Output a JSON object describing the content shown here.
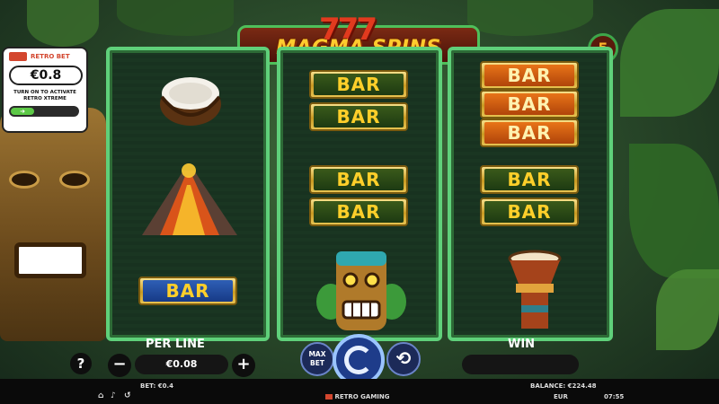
{
  "game": {
    "logo_number": "777",
    "logo_title": "MAGMA SPINS",
    "paylines": "5"
  },
  "retro_bet": {
    "brand": "RETRO BET",
    "amount": "€0.8",
    "note": "TURN ON TO ACTIVATE RETRO XTREME",
    "toggle_icon": "arrow-right-icon"
  },
  "reels": [
    {
      "symbols": [
        "coconut",
        "volcano",
        "BAR"
      ]
    },
    {
      "symbols": [
        "BAR",
        "BAR",
        "BAR",
        "BAR",
        "tiki-mask"
      ]
    },
    {
      "symbols": [
        "BAR",
        "BAR",
        "BAR",
        "BAR",
        "BAR",
        "drum"
      ]
    }
  ],
  "bar_label": "BAR",
  "controls": {
    "help_label": "?",
    "per_line_label": "PER LINE",
    "per_line_value": "€0.08",
    "minus_label": "−",
    "plus_label": "+",
    "max_bet_label": "MAX BET",
    "win_label": "WIN",
    "win_value": ""
  },
  "footer": {
    "bet": "BET: €0.4",
    "balance": "BALANCE: €224.48",
    "brand": "RETRO GAMING",
    "currency": "EUR",
    "time": "07:55"
  },
  "colors": {
    "reel_border": "#5fd07a",
    "bar_gold": "#c99a22",
    "logo_yellow": "#ffcb2e"
  }
}
